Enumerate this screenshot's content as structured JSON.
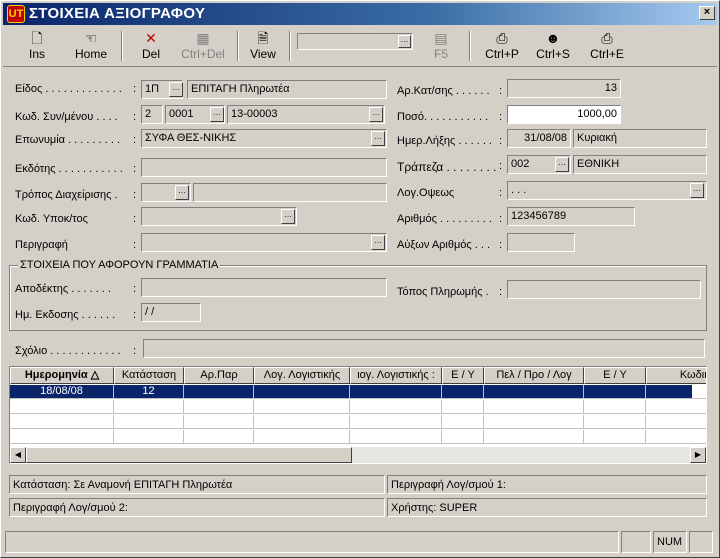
{
  "window": {
    "title": "ΣΤΟΙΧΕΙΑ ΑΞΙΟΓΡΑΦΟΥ",
    "close": "×",
    "app_icon": "UT"
  },
  "toolbar": {
    "ins": "Ins",
    "home": "Home",
    "del": "Del",
    "ctrl_del": "Ctrl+Del",
    "view": "View",
    "f5": "F5",
    "ctrl_p": "Ctrl+P",
    "ctrl_s": "Ctrl+S",
    "ctrl_e": "Ctrl+E",
    "combo_value": ""
  },
  "form": {
    "eidos": {
      "label": "Είδος . . . . . . . . . . . . .",
      "code": "1Π",
      "value": "ΕΠΙΤΑΓΗ Πληρωτέα"
    },
    "kod_syn": {
      "label": "Κωδ. Συν/μένου . . . .",
      "code1": "2",
      "code2": "0001",
      "value": "13-00003"
    },
    "eponymia": {
      "label": "Επωνυμία . . . . . . . . .",
      "value": "ΣΥΦΑ ΘΕΣ-ΝΙΚΗΣ"
    },
    "ekdotis": {
      "label": "Εκδότης . . . . . . . . . . .",
      "value": ""
    },
    "tropos": {
      "label": "Τρόπος Διαχείρισης .",
      "code": "",
      "value": ""
    },
    "kod_ypok": {
      "label": "Κωδ. Υποκ/τος",
      "value": ""
    },
    "perigrafi": {
      "label": "Περιγραφή",
      "value": ""
    },
    "ar_kat": {
      "label": "Αρ.Κατ/σης . . . . . .",
      "value": "13"
    },
    "poso": {
      "label": "Ποσό. . . . . . . . . . .",
      "value": "1000,00"
    },
    "im_lixis": {
      "label": "Ημερ.Λήξης . . . . . .",
      "date": "31/08/08",
      "day": "Κυριακή"
    },
    "trapeza": {
      "label": "Τράπεζα . . . . . . . .",
      "code": "002",
      "value": "ΕΘΝΙΚΗ"
    },
    "log_opseos": {
      "label": "Λογ.Οψεως",
      "value": ".     .     ."
    },
    "arithmos": {
      "label": "Αριθμός . . . . . . . . .",
      "value": "123456789"
    },
    "afxon": {
      "label": "Αύξων Αριθμός . . .",
      "value": ""
    },
    "colon": ":",
    "dots": "…"
  },
  "group": {
    "caption": "ΣΤΟΙΧΕΙΑ ΠΟΥ ΑΦΟΡΟΥΝ ΓΡΑΜΜΑΤΙΑ",
    "apodektis": {
      "label": "Αποδέκτης . . . . . . .",
      "value": ""
    },
    "topos": {
      "label": "Τόπος Πληρωμής .",
      "value": ""
    },
    "im_ekdosis": {
      "label": "Ημ. Εκδοσης . . . . . .",
      "value": "/ /"
    }
  },
  "scholio": {
    "label": "Σχόλιο . . . . . . . . . . . .",
    "value": ""
  },
  "grid": {
    "headers": [
      "Ημερομηνία",
      "Κατάσταση",
      "Αρ.Παρ",
      "Λογ. Λογιστικής",
      "ιογ. Λογιστικής :",
      "Ε / Υ",
      "Πελ / Προ / Λογ",
      "Ε / Υ",
      "Κωδικός"
    ],
    "sort_indicator": "△",
    "rows": [
      {
        "cells": [
          "18/08/08",
          "12",
          "",
          "",
          "",
          "",
          "",
          "",
          ""
        ],
        "selected": true
      },
      {
        "cells": [
          "",
          "",
          "",
          "",
          "",
          "",
          "",
          "",
          ""
        ],
        "selected": false
      },
      {
        "cells": [
          "",
          "",
          "",
          "",
          "",
          "",
          "",
          "",
          ""
        ],
        "selected": false
      },
      {
        "cells": [
          "",
          "",
          "",
          "",
          "",
          "",
          "",
          "",
          ""
        ],
        "selected": false
      }
    ],
    "left_arrow": "◀",
    "right_arrow": "▶"
  },
  "info": {
    "katastasi": "Κατάσταση: Σε Αναμονή  ΕΠΙΤΑΓΗ Πληρωτέα",
    "perigrafi1": "Περιγραφή Λογ/σμού 1:",
    "perigrafi2": "Περιγραφή Λογ/σμού 2:",
    "xristis": "Χρήστης: SUPER"
  },
  "status": {
    "num": "NUM"
  }
}
